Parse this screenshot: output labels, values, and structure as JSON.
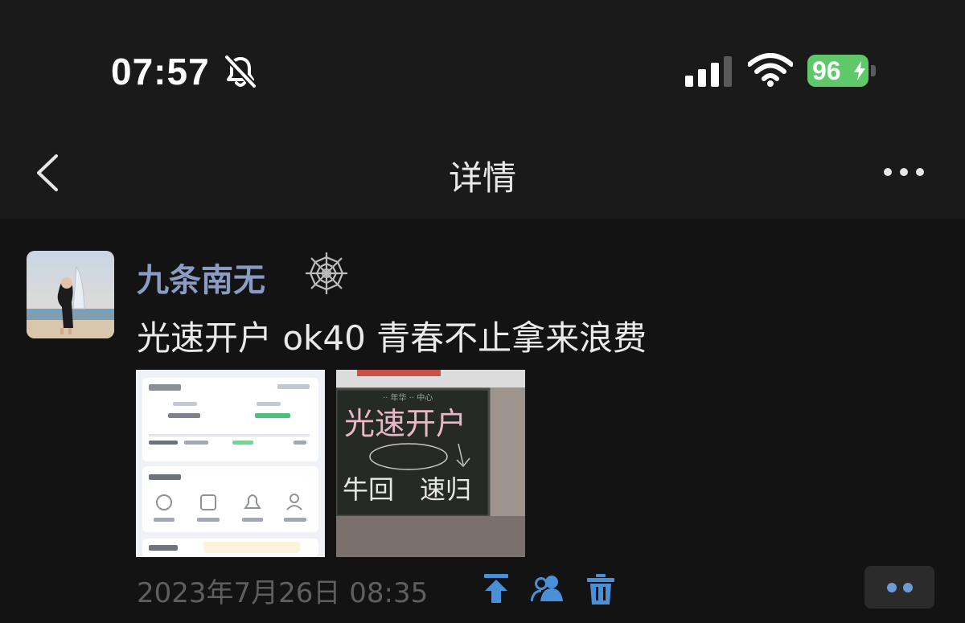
{
  "status_bar": {
    "time": "07:57",
    "battery": "96",
    "battery_color": "#5fc96a"
  },
  "nav": {
    "title": "详情"
  },
  "post": {
    "username": "九条南无",
    "username_color": "#8a9bc4",
    "text": "光速开户 ok40 青春不止拿来浪费",
    "timestamp": "2023年7月26日 08:35",
    "photos": [
      {
        "kind": "app-screenshot"
      },
      {
        "kind": "chalkboard-photo",
        "handwriting_line1": "光速开户",
        "handwriting_line2": "牛回　速归"
      }
    ]
  },
  "icons": {
    "bell": "bell-slash-icon",
    "signal": "signal-bars-icon",
    "wifi": "wifi-icon",
    "back": "chevron-left-icon",
    "more": "more-dots-icon",
    "web": "spider-web-icon",
    "pin": "pin-to-top-icon",
    "people": "people-icon",
    "trash": "trash-icon",
    "comment": "comment-dots-icon"
  }
}
